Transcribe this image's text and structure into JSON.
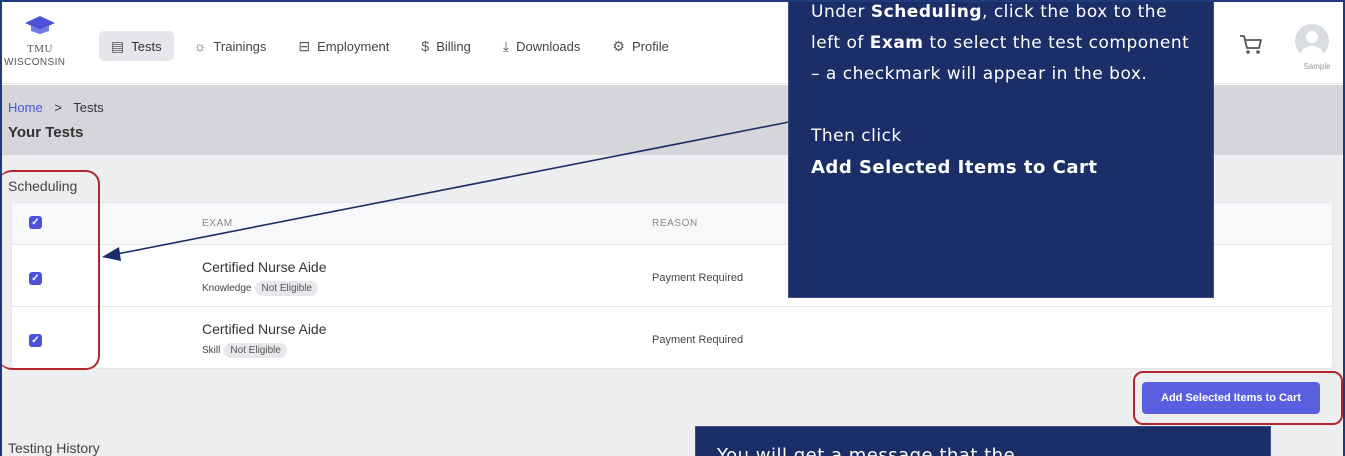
{
  "brand": {
    "org": "TMU",
    "state": "WISCONSIN"
  },
  "nav": {
    "items": [
      {
        "label": "Tests",
        "icon": "clipboard-icon",
        "glyph": "📋"
      },
      {
        "label": "Trainings",
        "icon": "lightbulb-icon",
        "glyph": "☼"
      },
      {
        "label": "Employment",
        "icon": "briefcase-icon",
        "glyph": "⊟"
      },
      {
        "label": "Billing",
        "icon": "dollar-icon",
        "glyph": "$"
      },
      {
        "label": "Downloads",
        "icon": "download-icon",
        "glyph": "⤓"
      },
      {
        "label": "Profile",
        "icon": "gear-icon",
        "glyph": "⚙"
      }
    ]
  },
  "user": {
    "label": "Sample"
  },
  "breadcrumb": {
    "home": "Home",
    "separator": ">",
    "current": "Tests"
  },
  "page": {
    "title": "Your Tests"
  },
  "scheduling": {
    "title": "Scheduling",
    "columns": {
      "exam": "EXAM",
      "reason": "REASON"
    },
    "rows": [
      {
        "name": "Certified Nurse Aide",
        "component": "Knowledge",
        "status": "Not Eligible",
        "reason": "Payment Required",
        "checked": true
      },
      {
        "name": "Certified Nurse Aide",
        "component": "Skill",
        "status": "Not Eligible",
        "reason": "Payment Required",
        "checked": true
      }
    ],
    "add_button": "Add Selected Items to Cart"
  },
  "history": {
    "title": "Testing History"
  },
  "callouts": {
    "main": {
      "p1_a": "Under ",
      "p1_b": "Scheduling",
      "p1_c": ", click the box to the left of ",
      "p1_d": "Exam",
      "p1_e": " to select the test component – a checkmark will appear in the box.",
      "p2_a": "Then click",
      "p2_b": "Add Selected Items to Cart"
    },
    "bottom": "You will get a message that the"
  },
  "colors": {
    "accent": "#5a5fe0",
    "callout": "#1c2e67",
    "annotation": "#b3262e",
    "checkbox": "#4b52d8"
  }
}
